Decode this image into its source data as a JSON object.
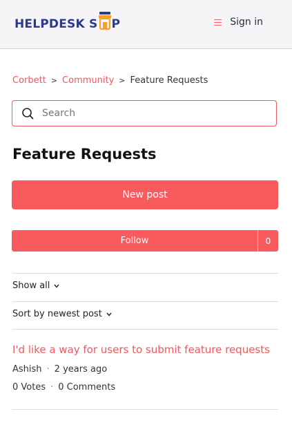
{
  "header": {
    "logo_part1": "HELPDESK S",
    "logo_part2": "P",
    "sign_in": "Sign in"
  },
  "breadcrumb": {
    "items": [
      "Corbett",
      "Community"
    ],
    "separator": ">",
    "current": "Feature Requests"
  },
  "search": {
    "placeholder": "Search",
    "value": ""
  },
  "page": {
    "title": "Feature Requests"
  },
  "actions": {
    "new_post": "New post",
    "follow": "Follow",
    "follow_count": "0"
  },
  "filters": {
    "show": "Show all",
    "sort": "Sort by newest post"
  },
  "posts": [
    {
      "title": "I'd like a way for users to submit feature requests",
      "author": "Ashish",
      "time": "2 years ago",
      "votes": "0 Votes",
      "comments": "0 Comments"
    }
  ],
  "colors": {
    "accent": "#f85b5e",
    "link": "#f0595d",
    "logo_blue": "#2b3a8f",
    "logo_orange": "#f7a12b",
    "header_bg": "#f5f5f7"
  },
  "icons": {
    "menu": "hamburger-icon",
    "search": "search-icon",
    "dropdown": "chevron-down-icon",
    "logo": "shop-awning-icon"
  }
}
